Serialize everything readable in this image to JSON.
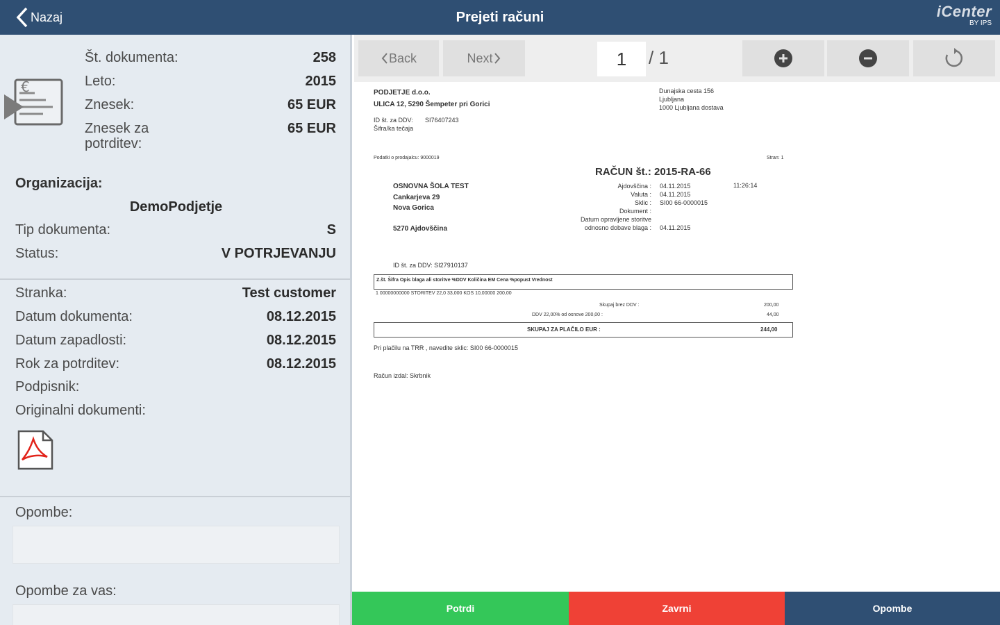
{
  "header": {
    "back_label": "Nazaj",
    "title": "Prejeti računi",
    "logo_main": "iCenter",
    "logo_sub": "BY IPS"
  },
  "summary": {
    "doc_number_label": "Št. dokumenta:",
    "doc_number": "258",
    "year_label": "Leto:",
    "year": "2015",
    "amount_label": "Znesek:",
    "amount": "65 EUR",
    "amount_confirm_label": "Znesek za potrditev:",
    "amount_confirm": "65 EUR"
  },
  "organization": {
    "label": "Organizacija:",
    "name": "DemoPodjetje",
    "doc_type_label": "Tip dokumenta:",
    "doc_type": "S",
    "status_label": "Status:",
    "status": "V POTRJEVANJU"
  },
  "details": {
    "customer_label": "Stranka:",
    "customer": "Test customer",
    "doc_date_label": "Datum dokumenta:",
    "doc_date": "08.12.2015",
    "due_date_label": "Datum zapadlosti:",
    "due_date": "08.12.2015",
    "confirm_deadline_label": "Rok za potrditev:",
    "confirm_deadline": "08.12.2015",
    "signer_label": "Podpisnik:",
    "original_docs_label": "Originalni dokumenti:"
  },
  "notes": {
    "notes_label": "Opombe:",
    "notes_for_you_label": "Opombe za vas:"
  },
  "viewer": {
    "back_label": "Back",
    "next_label": "Next",
    "page_current": "1",
    "page_total": "/ 1"
  },
  "invoice": {
    "company": "PODJETJE d.o.o.",
    "company_address": "ULICA 12, 5290 Šempeter pri Gorici",
    "vat_label": "ID št. za DDV:",
    "vat_value": "SI76407243",
    "seller_label": "Šifra/ka tečaja",
    "right_addr_1": "Dunajska cesta 156",
    "right_addr_2": "Ljubljana",
    "right_addr_3": "1000 Ljubljana dostava",
    "small_ref": "Podatki o prodajalcu: 9000019",
    "page_label": "Stran: 1",
    "invoice_title": "RAČUN št.: 2015-RA-66",
    "buyer_1": "OSNOVNA ŠOLA TEST",
    "buyer_2": "Cankarjeva 29",
    "buyer_3": "Nova Gorica",
    "buyer_4": "5270 Ajdovščina",
    "meta_labels": "Ajdovščina :\nValuta :\nSklic :\nDokument :\nDatum opravljene storitve\nodnosno dobave blaga :",
    "meta_values": "04.11.2015\n04.11.2015\nSI00 66-0000015\n\n\n04.11.2015",
    "meta_time": "11:26:14",
    "buyer_vat": "ID št. za DDV: SI27910137",
    "table_header": "Z.št.    Šifra      Opis blaga ali storitve                                    %DDV        Količina    EM        Cena       %popust         Vrednost",
    "table_row": "1   00000000000   STORITEV                                                    22,0          33,000     KOS      10,00000                             200,00",
    "subtotal_label": "Skupaj brez DDV :",
    "subtotal_value": "200,00",
    "vat_line": "DDV 22,00%  od osnove 200,00 :",
    "vat_line_value": "44,00",
    "total_label": "SKUPAJ ZA PLAČILO EUR :",
    "total_value": "244,00",
    "payment_note": "Pri plačilu na TRR , navedite sklic: SI00 66-0000015",
    "issuer": "Račun izdal:    Skrbnik"
  },
  "actions": {
    "confirm": "Potrdi",
    "reject": "Zavrni",
    "notes": "Opombe"
  },
  "colors": {
    "header": "#2f4f73",
    "confirm": "#34c759",
    "reject": "#ef4136",
    "notes": "#2f4f73"
  }
}
